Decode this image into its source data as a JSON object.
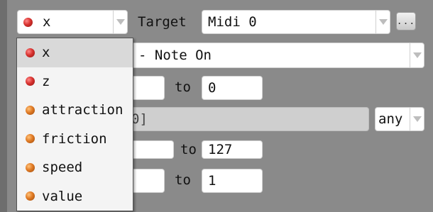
{
  "selector": {
    "value": "x"
  },
  "target": {
    "label": "Target",
    "value": "Midi 0",
    "more_button": "..."
  },
  "message": {
    "value": "- Note On"
  },
  "range1": {
    "to_label": "to",
    "to_value": "0"
  },
  "pattern": {
    "value": "0]",
    "scope": "any"
  },
  "range2": {
    "to_label": "to",
    "to_value": "127"
  },
  "range3": {
    "to_label": "to",
    "to_value": "1"
  },
  "dropdown": {
    "items": [
      {
        "label": "x",
        "color": "red"
      },
      {
        "label": "z",
        "color": "red"
      },
      {
        "label": "attraction",
        "color": "orange"
      },
      {
        "label": "friction",
        "color": "orange"
      },
      {
        "label": "speed",
        "color": "orange"
      },
      {
        "label": "value",
        "color": "orange"
      }
    ]
  },
  "colors": {
    "red_dot": "#d8322f",
    "orange_dot": "#e07a24",
    "panel": "#8a8a8a"
  }
}
